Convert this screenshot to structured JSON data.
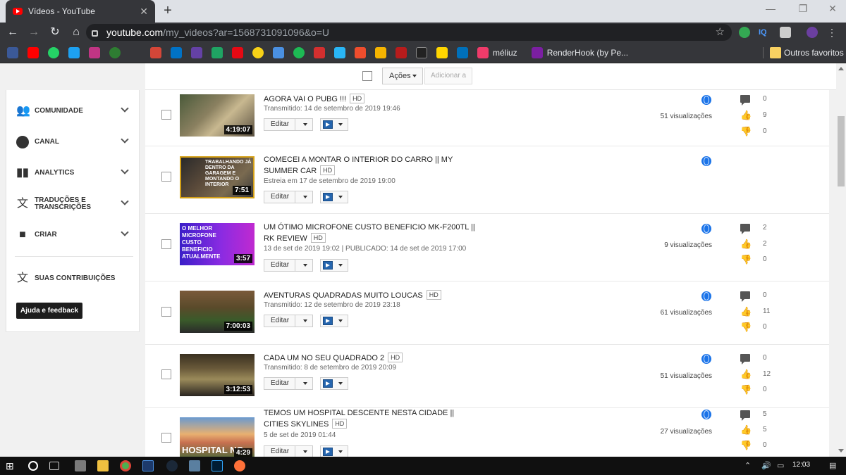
{
  "browser": {
    "tab_title": "Vídeos - YouTube",
    "url_host": "youtube.com",
    "url_path": "/my_videos?ar=1568731091096&o=U",
    "bookmark_text_meliuz": "méliuz",
    "bookmark_text_renderhook": "RenderHook (by Pe...",
    "bookmark_text_outros": "Outros favoritos"
  },
  "toolbar": {
    "acoes_label": "Ações",
    "adicionar_label": "Adicionar a"
  },
  "sidebar": {
    "items": [
      {
        "label": "COMUNIDADE",
        "icon": "people-icon"
      },
      {
        "label": "CANAL",
        "icon": "account-icon"
      },
      {
        "label": "ANALYTICS",
        "icon": "bar-chart-icon"
      },
      {
        "label": "TRADUÇÕES E TRANSCRIÇÕES",
        "icon": "translate-icon"
      },
      {
        "label": "CRIAR",
        "icon": "video-camera-icon"
      }
    ],
    "contributions": "SUAS CONTRIBUIÇÕES",
    "feedback": "Ajuda e feedback"
  },
  "videos": [
    {
      "title": "AGORA VAI O PUBG !!!",
      "hd": "HD",
      "meta": "Transmitido: 14 de setembro de 2019 19:46",
      "duration": "4:19:07",
      "thumb_text": "",
      "views": "51 visualizações",
      "comments": "0",
      "likes": "9",
      "dislikes": "0",
      "edit": "Editar"
    },
    {
      "title": "COMECEI A MONTAR O INTERIOR DO CARRO || MY SUMMER CAR",
      "hd": "HD",
      "meta": "Estreia em 17 de setembro de 2019 19:00",
      "duration": "7:51",
      "thumb_text": "TRABALHANDO JÁ DENTRO DA GARAGEM E MONTANDO O INTERIOR",
      "views": "",
      "comments": "",
      "likes": "",
      "dislikes": "",
      "edit": "Editar"
    },
    {
      "title": "UM ÓTIMO MICROFONE CUSTO BENEFICIO MK-F200TL || RK REVIEW",
      "hd": "HD",
      "meta": "13 de set de 2019 19:02 | PUBLICADO: 14 de set de 2019 17:00",
      "duration": "3:57",
      "thumb_text": "O MELHOR MICROFONE CUSTO BENEFICIO ATUALMENTE",
      "views": "9 visualizações",
      "comments": "2",
      "likes": "2",
      "dislikes": "0",
      "edit": "Editar"
    },
    {
      "title": "AVENTURAS QUADRADAS MUITO LOUCAS",
      "hd": "HD",
      "meta": "Transmitido: 12 de setembro de 2019 23:18",
      "duration": "7:00:03",
      "thumb_text": "",
      "views": "61 visualizações",
      "comments": "0",
      "likes": "11",
      "dislikes": "0",
      "edit": "Editar"
    },
    {
      "title": "CADA UM NO SEU QUADRADO 2",
      "hd": "HD",
      "meta": "Transmitido: 8 de setembro de 2019 20:09",
      "duration": "3:12:53",
      "thumb_text": "",
      "views": "51 visualizações",
      "comments": "0",
      "likes": "12",
      "dislikes": "0",
      "edit": "Editar"
    },
    {
      "title": "TEMOS UM HOSPITAL DESCENTE NESTA CIDADE || CITIES SKYLINES",
      "hd": "HD",
      "meta": "5 de set de 2019 01:44",
      "duration": "4:29",
      "thumb_text": "HOSPITAL NO",
      "views": "27 visualizações",
      "comments": "5",
      "likes": "5",
      "dislikes": "0",
      "edit": "Editar"
    }
  ],
  "taskbar": {
    "clock": "12:03"
  }
}
